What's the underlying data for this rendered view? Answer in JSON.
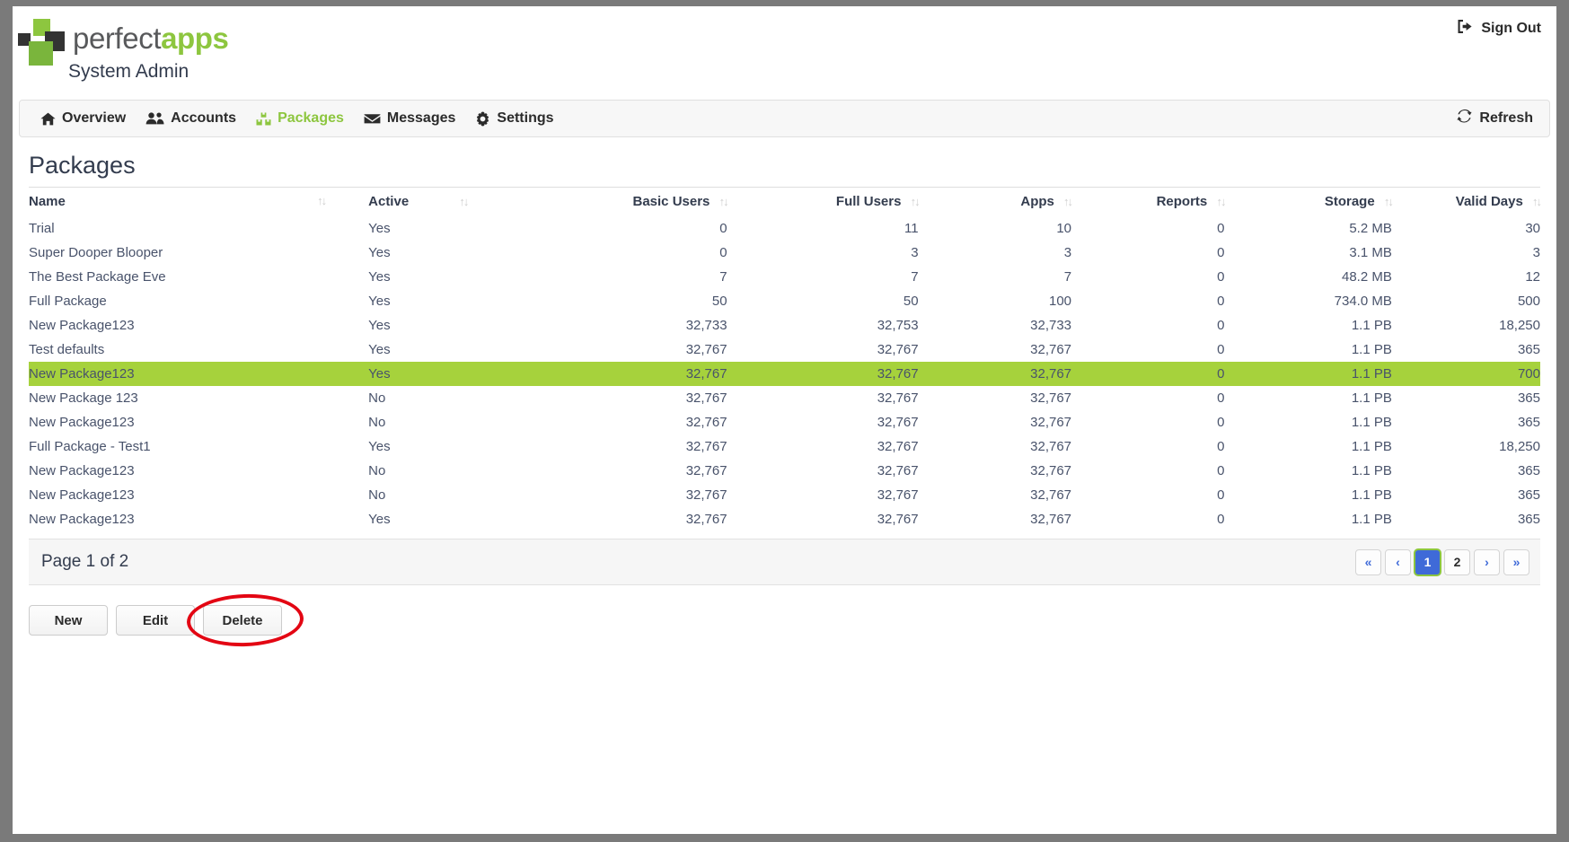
{
  "header": {
    "logo_perfect": "perfect",
    "logo_apps": "apps",
    "subtitle": "System Admin",
    "sign_out": "Sign Out",
    "sign_out_icon": "sign-out-icon"
  },
  "nav": {
    "items": [
      {
        "label": "Overview",
        "icon": "home-icon",
        "active": false
      },
      {
        "label": "Accounts",
        "icon": "users-icon",
        "active": false
      },
      {
        "label": "Packages",
        "icon": "packages-icon",
        "active": true
      },
      {
        "label": "Messages",
        "icon": "envelope-icon",
        "active": false
      },
      {
        "label": "Settings",
        "icon": "gear-icon",
        "active": false
      }
    ],
    "refresh": "Refresh",
    "refresh_icon": "refresh-icon"
  },
  "page": {
    "title": "Packages"
  },
  "table": {
    "sort_icon": "sort-updown-icon",
    "columns": [
      {
        "label": "Name",
        "align": "left"
      },
      {
        "label": "Active",
        "align": "left"
      },
      {
        "label": "Basic Users",
        "align": "right"
      },
      {
        "label": "Full Users",
        "align": "right"
      },
      {
        "label": "Apps",
        "align": "right"
      },
      {
        "label": "Reports",
        "align": "right"
      },
      {
        "label": "Storage",
        "align": "right"
      },
      {
        "label": "Valid Days",
        "align": "right"
      }
    ],
    "rows": [
      {
        "name": "Trial",
        "active": "Yes",
        "basic_users": "0",
        "full_users": "11",
        "apps": "10",
        "reports": "0",
        "storage": "5.2 MB",
        "valid_days": "30",
        "selected": false
      },
      {
        "name": "Super Dooper Blooper",
        "active": "Yes",
        "basic_users": "0",
        "full_users": "3",
        "apps": "3",
        "reports": "0",
        "storage": "3.1 MB",
        "valid_days": "3",
        "selected": false
      },
      {
        "name": "The Best Package Eve",
        "active": "Yes",
        "basic_users": "7",
        "full_users": "7",
        "apps": "7",
        "reports": "0",
        "storage": "48.2 MB",
        "valid_days": "12",
        "selected": false
      },
      {
        "name": "Full Package",
        "active": "Yes",
        "basic_users": "50",
        "full_users": "50",
        "apps": "100",
        "reports": "0",
        "storage": "734.0 MB",
        "valid_days": "500",
        "selected": false
      },
      {
        "name": "New Package123",
        "active": "Yes",
        "basic_users": "32,733",
        "full_users": "32,753",
        "apps": "32,733",
        "reports": "0",
        "storage": "1.1 PB",
        "valid_days": "18,250",
        "selected": false
      },
      {
        "name": "Test defaults",
        "active": "Yes",
        "basic_users": "32,767",
        "full_users": "32,767",
        "apps": "32,767",
        "reports": "0",
        "storage": "1.1 PB",
        "valid_days": "365",
        "selected": false
      },
      {
        "name": "New Package123",
        "active": "Yes",
        "basic_users": "32,767",
        "full_users": "32,767",
        "apps": "32,767",
        "reports": "0",
        "storage": "1.1 PB",
        "valid_days": "700",
        "selected": true
      },
      {
        "name": "New Package 123",
        "active": "No",
        "basic_users": "32,767",
        "full_users": "32,767",
        "apps": "32,767",
        "reports": "0",
        "storage": "1.1 PB",
        "valid_days": "365",
        "selected": false
      },
      {
        "name": "New Package123",
        "active": "No",
        "basic_users": "32,767",
        "full_users": "32,767",
        "apps": "32,767",
        "reports": "0",
        "storage": "1.1 PB",
        "valid_days": "365",
        "selected": false
      },
      {
        "name": "Full Package - Test1",
        "active": "Yes",
        "basic_users": "32,767",
        "full_users": "32,767",
        "apps": "32,767",
        "reports": "0",
        "storage": "1.1 PB",
        "valid_days": "18,250",
        "selected": false
      },
      {
        "name": "New Package123",
        "active": "No",
        "basic_users": "32,767",
        "full_users": "32,767",
        "apps": "32,767",
        "reports": "0",
        "storage": "1.1 PB",
        "valid_days": "365",
        "selected": false
      },
      {
        "name": "New Package123",
        "active": "No",
        "basic_users": "32,767",
        "full_users": "32,767",
        "apps": "32,767",
        "reports": "0",
        "storage": "1.1 PB",
        "valid_days": "365",
        "selected": false
      },
      {
        "name": "New Package123",
        "active": "Yes",
        "basic_users": "32,767",
        "full_users": "32,767",
        "apps": "32,767",
        "reports": "0",
        "storage": "1.1 PB",
        "valid_days": "365",
        "selected": false
      }
    ]
  },
  "pager": {
    "label": "Page 1 of 2",
    "first": "«",
    "prev": "‹",
    "next": "›",
    "last": "»",
    "pages": [
      "1",
      "2"
    ],
    "active_page": "1"
  },
  "actions": {
    "new_label": "New",
    "edit_label": "Edit",
    "delete_label": "Delete",
    "annotation": "red-ellipse-around-delete"
  },
  "colors": {
    "brand_green": "#8dc63f",
    "row_highlight": "#a6d23c",
    "pager_active": "#3f6ad8",
    "annotation_red": "#e30613",
    "text_dark": "#333c4e"
  }
}
